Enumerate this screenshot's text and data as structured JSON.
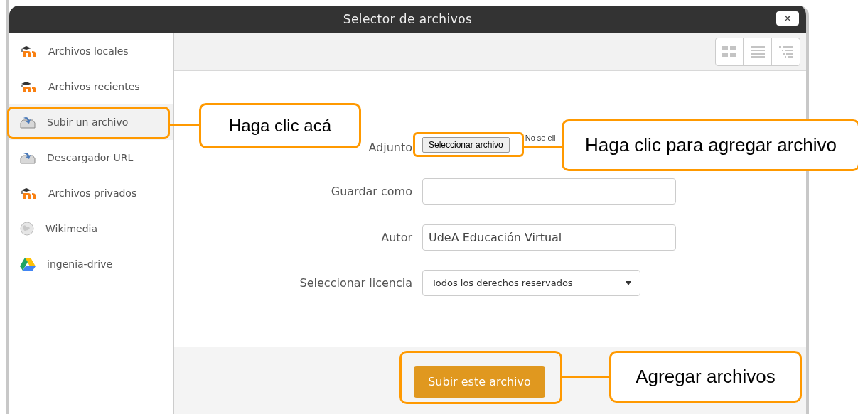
{
  "window": {
    "title": "Selector de archivos",
    "close": "✕"
  },
  "sidebar": {
    "items": [
      {
        "label": "Archivos locales",
        "kind": "cap",
        "selected": false
      },
      {
        "label": "Archivos recientes",
        "kind": "cap",
        "selected": false
      },
      {
        "label": "Subir un archivo",
        "kind": "upload",
        "selected": true
      },
      {
        "label": "Descargador URL",
        "kind": "upload",
        "selected": false
      },
      {
        "label": "Archivos privados",
        "kind": "cap",
        "selected": false
      },
      {
        "label": "Wikimedia",
        "kind": "globe",
        "selected": false
      },
      {
        "label": "ingenia-drive",
        "kind": "triangle",
        "selected": false
      }
    ]
  },
  "form": {
    "attachment": {
      "label": "Adjunto",
      "button": "Seleccionar archivo",
      "status": "No se eli"
    },
    "save_as": {
      "label": "Guardar como"
    },
    "author": {
      "label": "Autor",
      "value": "UdeA Educación Virtual"
    },
    "license": {
      "label": "Seleccionar licencia",
      "value": "Todos los derechos reservados"
    },
    "submit": "Subir este archivo"
  },
  "annotations": [
    {
      "text": "Haga clic acá"
    },
    {
      "text": "Haga clic para agregar archivo"
    },
    {
      "text": "Agregar archivos"
    }
  ]
}
